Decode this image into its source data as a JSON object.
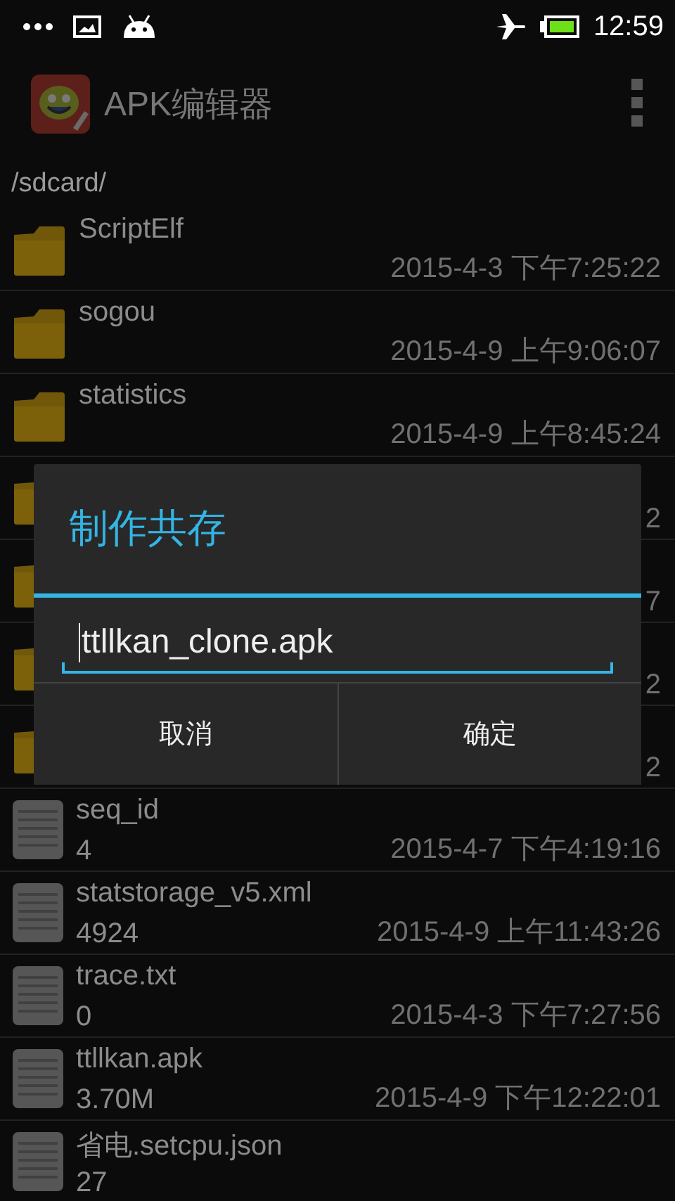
{
  "status_bar": {
    "time": "12:59"
  },
  "action_bar": {
    "title": "APK编辑器"
  },
  "path": "/sdcard/",
  "files": [
    {
      "kind": "folder",
      "name": "ScriptElf",
      "date": "2015-4-3 下午7:25:22"
    },
    {
      "kind": "folder",
      "name": "sogou",
      "date": "2015-4-9 上午9:06:07"
    },
    {
      "kind": "folder",
      "name": "statistics",
      "date": "2015-4-9 上午8:45:24"
    },
    {
      "kind": "folder",
      "date": "2"
    },
    {
      "kind": "folder",
      "date": "7"
    },
    {
      "kind": "folder",
      "date": "2"
    },
    {
      "kind": "folder",
      "date": "2"
    },
    {
      "kind": "file",
      "name": "seq_id",
      "size": "4",
      "date": "2015-4-7 下午4:19:16"
    },
    {
      "kind": "file",
      "name": "statstorage_v5.xml",
      "size": "4924",
      "date": "2015-4-9 上午11:43:26"
    },
    {
      "kind": "file",
      "name": "trace.txt",
      "size": "0",
      "date": "2015-4-3 下午7:27:56"
    },
    {
      "kind": "file",
      "name": "ttllkan.apk",
      "size": "3.70M",
      "date": "2015-4-9 下午12:22:01"
    },
    {
      "kind": "file",
      "name": "省电.setcpu.json",
      "size": "27"
    }
  ],
  "dialog": {
    "title": "制作共存",
    "input_value": "ttllkan_clone.apk",
    "buttons": [
      "取消",
      "确定"
    ]
  }
}
